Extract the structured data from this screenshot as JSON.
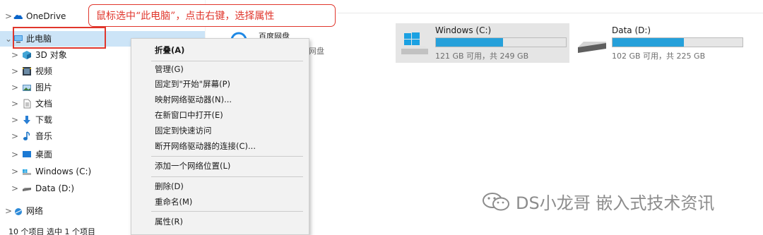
{
  "annotation": {
    "text": "鼠标选中“此电脑”，点击右键，选择属性"
  },
  "nav": {
    "items": [
      {
        "chevron": ">",
        "label": "OneDrive",
        "icon": "onedrive-cloud-icon"
      },
      {
        "chevron": "⌄",
        "label": "此电脑",
        "icon": "this-pc-icon",
        "selected": true
      },
      {
        "chevron": ">",
        "label": "3D 对象",
        "icon": "3d-objects-icon"
      },
      {
        "chevron": ">",
        "label": "视频",
        "icon": "videos-icon"
      },
      {
        "chevron": ">",
        "label": "图片",
        "icon": "pictures-icon"
      },
      {
        "chevron": ">",
        "label": "文档",
        "icon": "documents-icon"
      },
      {
        "chevron": ">",
        "label": "下载",
        "icon": "downloads-icon"
      },
      {
        "chevron": ">",
        "label": "音乐",
        "icon": "music-icon"
      },
      {
        "chevron": ">",
        "label": "桌面",
        "icon": "desktop-icon"
      },
      {
        "chevron": ">",
        "label": "Windows (C:)",
        "icon": "windows-drive-icon"
      },
      {
        "chevron": ">",
        "label": "Data (D:)",
        "icon": "data-drive-icon"
      },
      {
        "chevron": ">",
        "label": "网络",
        "icon": "network-icon"
      }
    ]
  },
  "context_menu": {
    "items": [
      {
        "label": "折叠(A)",
        "bold": true
      },
      {
        "label": "管理(G)"
      },
      {
        "label": "固定到\"开始\"屏幕(P)"
      },
      {
        "label": "映射网络驱动器(N)..."
      },
      {
        "label": "在新窗口中打开(E)"
      },
      {
        "label": "固定到快速访问"
      },
      {
        "label": "断开网络驱动器的连接(C)..."
      },
      {
        "label": "添加一个网络位置(L)"
      },
      {
        "label": "删除(D)"
      },
      {
        "label": "重命名(M)"
      },
      {
        "label": "属性(R)"
      }
    ]
  },
  "content": {
    "baidu_partial_title": "百度网盘",
    "baidu_partial_sub": "网盘",
    "drives": [
      {
        "name": "Windows (C:)",
        "info": "121 GB 可用，共 249 GB",
        "used_fraction": 0.514,
        "selected": true
      },
      {
        "name": "Data (D:)",
        "info": "102 GB 可用，共 225 GB",
        "used_fraction": 0.547,
        "selected": false
      }
    ]
  },
  "status_bar": {
    "text": "10 个项目    选中 1 个项目"
  },
  "watermark": {
    "text": "DS小龙哥 嵌入式技术资讯"
  },
  "colors": {
    "accent_red": "#e0362c",
    "selection_blue": "#cce4f7",
    "bar_blue": "#26a0da"
  }
}
